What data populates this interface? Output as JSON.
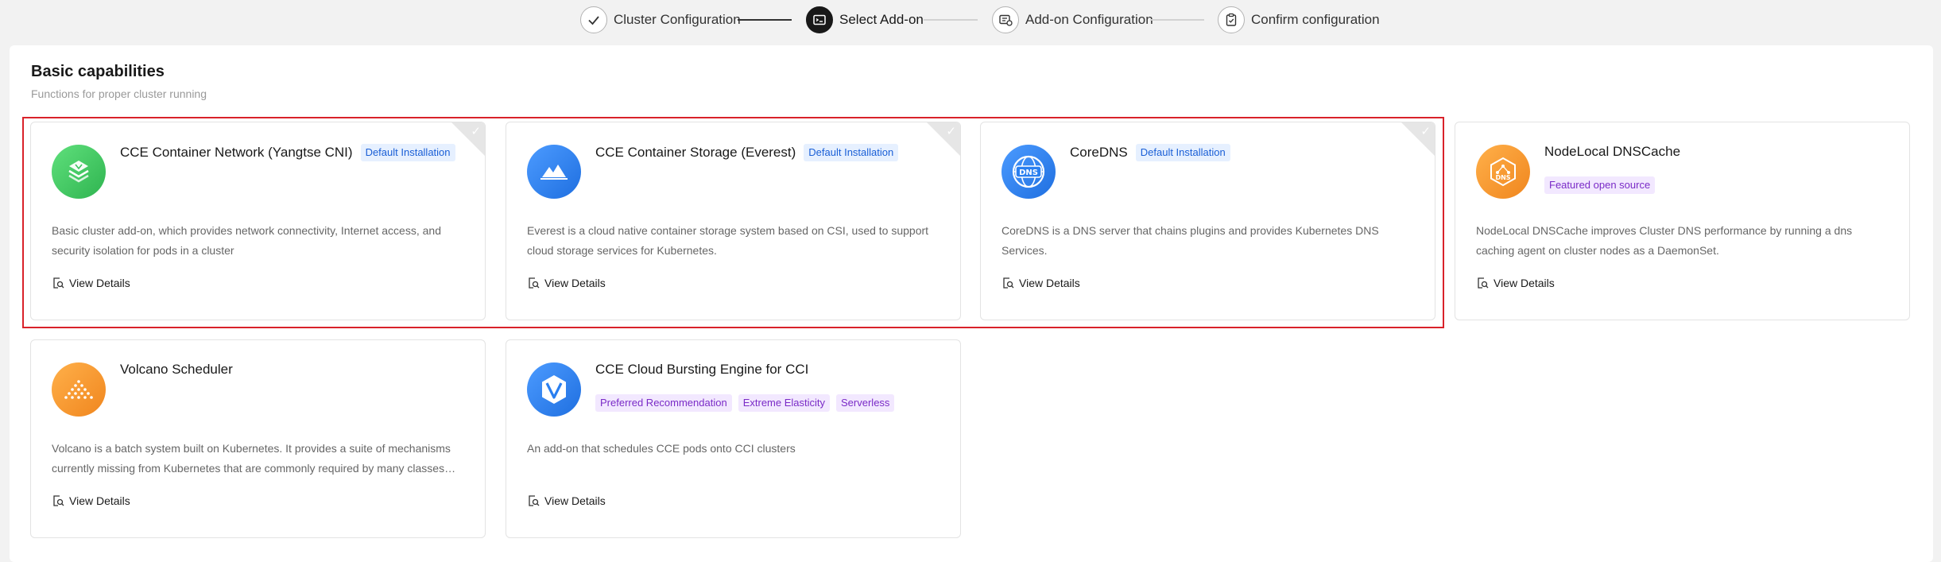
{
  "stepper": {
    "steps": [
      {
        "label": "Cluster Configuration",
        "icon": "check-icon",
        "state": "done"
      },
      {
        "label": "Select Add-on",
        "icon": "addon-icon",
        "state": "active"
      },
      {
        "label": "Add-on Configuration",
        "icon": "addon-config-icon",
        "state": "pending"
      },
      {
        "label": "Confirm configuration",
        "icon": "clipboard-icon",
        "state": "pending"
      }
    ]
  },
  "section": {
    "title": "Basic capabilities",
    "description": "Functions for proper cluster running"
  },
  "view_details_label": "View Details",
  "addons": [
    {
      "name": "CCE Container Network (Yangtse CNI)",
      "tag": "Default Installation",
      "description": "Basic cluster add-on, which provides network connectivity, Internet access, and security isolation for pods in a cluster",
      "icon": "network-icon",
      "color": "#3bc45e",
      "selected": true
    },
    {
      "name": "CCE Container Storage (Everest)",
      "tag": "Default Installation",
      "description": "Everest is a cloud native container storage system based on CSI, used to support cloud storage services for Kubernetes.",
      "icon": "mountain-icon",
      "color": "#2a7ff0",
      "selected": true
    },
    {
      "name": "CoreDNS",
      "tag": "Default Installation",
      "description": "CoreDNS is a DNS server that chains plugins and provides Kubernetes DNS Services.",
      "icon": "dns-globe-icon",
      "color": "#2a7ff0",
      "selected": true
    },
    {
      "name": "NodeLocal DNSCache",
      "tags": [
        "Featured open source"
      ],
      "description": "NodeLocal DNSCache improves Cluster DNS performance by running a dns caching agent on cluster nodes as a DaemonSet.",
      "icon": "dns-hex-icon",
      "color": "#f7952e",
      "selected": false
    },
    {
      "name": "Volcano Scheduler",
      "description": "Volcano is a batch system built on Kubernetes. It provides a suite of mechanisms currently missing from Kubernetes that are commonly required by many classes of...",
      "icon": "volcano-icon",
      "color": "#f7952e",
      "selected": false
    },
    {
      "name": "CCE Cloud Bursting Engine for CCI",
      "tags": [
        "Preferred Recommendation",
        "Extreme Elasticity",
        "Serverless"
      ],
      "description": "An add-on that schedules CCE pods onto CCI clusters",
      "icon": "hexagon-v-icon",
      "color": "#2a7ff0",
      "selected": false
    }
  ],
  "colors": {
    "highlight_border": "#d9222a",
    "default_tag_bg": "#e6f0ff",
    "default_tag_text": "#1a5fd6",
    "purple_tag_bg": "#f2e8ff",
    "purple_tag_text": "#7a2bc7"
  }
}
